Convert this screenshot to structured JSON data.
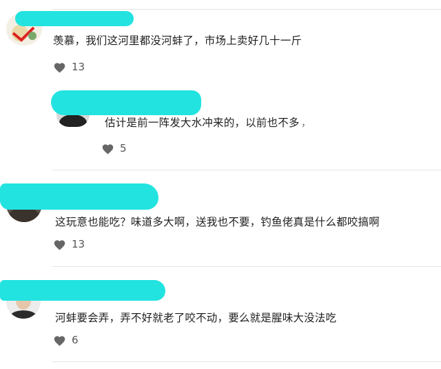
{
  "comments": [
    {
      "text": "羡慕，我们这河里都没河蚌了，市场上卖好几十一斤",
      "likes": "13",
      "reply": {
        "text": "估计是前一阵发大水冲来的，以前也不多",
        "likes": "5"
      }
    },
    {
      "text": "这玩意也能吃？味道多大啊，送我也不要，钓鱼佬真是什么都咬搞啊",
      "likes": "13"
    },
    {
      "text": "河蚌要会弄，弄不好就老了咬不动，要么就是腥味大没法吃",
      "likes": "6"
    }
  ],
  "stray_mark": "，",
  "colors": {
    "redaction": "#22e3e0",
    "heart": "#666666",
    "divider": "#e6e6e6"
  },
  "icons": {
    "like": "heart-icon"
  }
}
